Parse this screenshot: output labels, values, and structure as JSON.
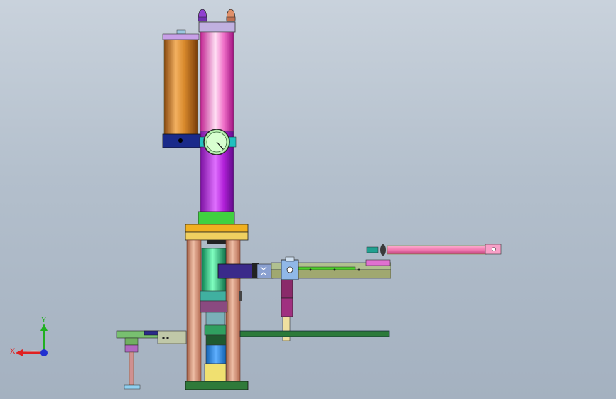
{
  "viewport": {
    "background_top": "#c9d2dc",
    "background_bottom": "#a4b1c0"
  },
  "triad": {
    "x_label": "X",
    "y_label": "Y",
    "x_color": "#e02020",
    "y_color": "#20b020",
    "z_color": "#2030d0"
  },
  "model": {
    "icon": "assembly-model-icon",
    "colors": {
      "copper_cylinder": "#d98a2c",
      "pink_cylinder": "#f060c0",
      "purple_cylinder": "#b020d8",
      "base_green": "#2f7a3a",
      "plate_orange": "#f0a020",
      "rod_pink": "#f07ab0",
      "pole_copper": "#d08a6a",
      "rail_green": "#4cd02a"
    }
  }
}
